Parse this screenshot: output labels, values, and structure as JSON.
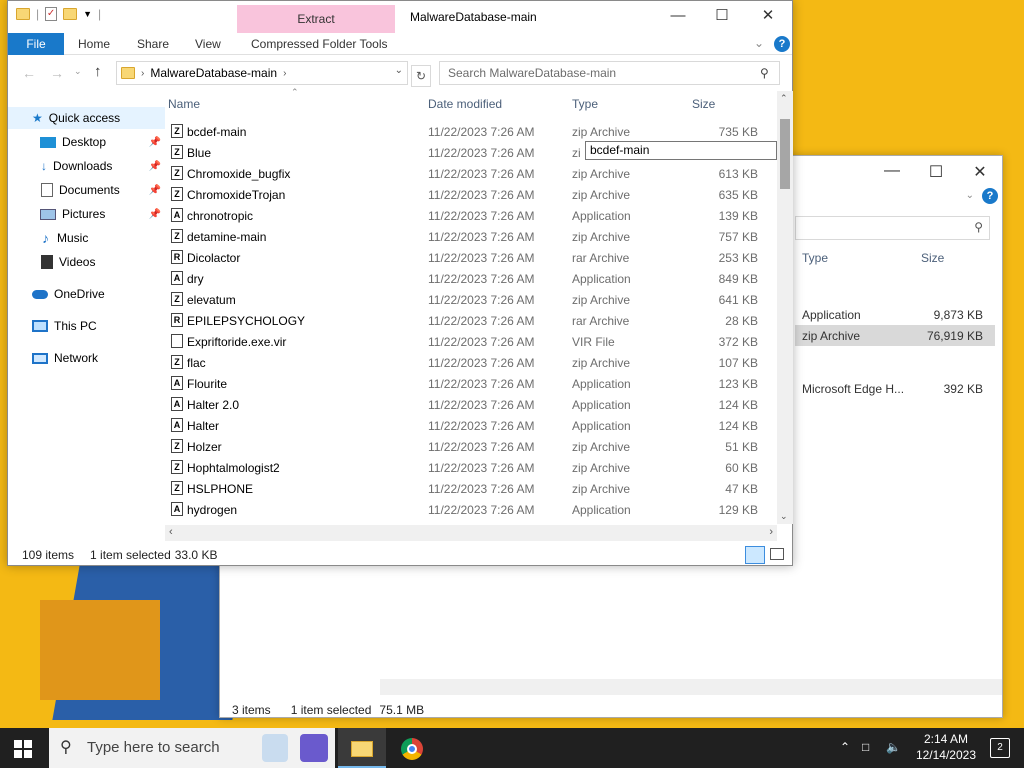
{
  "window": {
    "title": "MalwareDatabase-main",
    "extract_tab": "Extract",
    "ribbon_tabs": [
      "File",
      "Home",
      "Share",
      "View",
      "Compressed Folder Tools"
    ],
    "address": "MalwareDatabase-main",
    "search_placeholder": "Search MalwareDatabase-main",
    "columns": [
      "Name",
      "Date modified",
      "Type",
      "Size"
    ],
    "tooltip": "bcdef-main",
    "status_items": "109 items",
    "status_selected": "1 item selected",
    "status_size": "33.0 KB"
  },
  "nav": [
    {
      "label": "Quick access",
      "icon": "star-icon",
      "pinned": false
    },
    {
      "label": "Desktop",
      "icon": "desktop-icon",
      "pinned": true
    },
    {
      "label": "Downloads",
      "icon": "download-icon",
      "pinned": true
    },
    {
      "label": "Documents",
      "icon": "documents-icon",
      "pinned": true
    },
    {
      "label": "Pictures",
      "icon": "pictures-icon",
      "pinned": true
    },
    {
      "label": "Music",
      "icon": "music-icon",
      "pinned": false
    },
    {
      "label": "Videos",
      "icon": "videos-icon",
      "pinned": false
    },
    {
      "label": "OneDrive",
      "icon": "onedrive-icon",
      "pinned": false
    },
    {
      "label": "This PC",
      "icon": "pc-icon",
      "pinned": false
    },
    {
      "label": "Network",
      "icon": "network-icon",
      "pinned": false
    }
  ],
  "files": [
    {
      "name": "bcdef-main",
      "date": "11/22/2023 7:26 AM",
      "type": "zip Archive",
      "size": "735 KB",
      "icon": "Z"
    },
    {
      "name": "Blue",
      "date": "11/22/2023 7:26 AM",
      "type": "zi",
      "size": "",
      "icon": "Z"
    },
    {
      "name": "Chromoxide_bugfix",
      "date": "11/22/2023 7:26 AM",
      "type": "zip Archive",
      "size": "613 KB",
      "icon": "Z"
    },
    {
      "name": "ChromoxideTrojan",
      "date": "11/22/2023 7:26 AM",
      "type": "zip Archive",
      "size": "635 KB",
      "icon": "Z"
    },
    {
      "name": "chronotropic",
      "date": "11/22/2023 7:26 AM",
      "type": "Application",
      "size": "139 KB",
      "icon": "A"
    },
    {
      "name": "detamine-main",
      "date": "11/22/2023 7:26 AM",
      "type": "zip Archive",
      "size": "757 KB",
      "icon": "Z"
    },
    {
      "name": "Dicolactor",
      "date": "11/22/2023 7:26 AM",
      "type": "rar Archive",
      "size": "253 KB",
      "icon": "R"
    },
    {
      "name": "dry",
      "date": "11/22/2023 7:26 AM",
      "type": "Application",
      "size": "849 KB",
      "icon": "A"
    },
    {
      "name": "elevatum",
      "date": "11/22/2023 7:26 AM",
      "type": "zip Archive",
      "size": "641 KB",
      "icon": "Z"
    },
    {
      "name": "EPILEPSYCHOLOGY",
      "date": "11/22/2023 7:26 AM",
      "type": "rar Archive",
      "size": "28 KB",
      "icon": "R"
    },
    {
      "name": "Expriftoride.exe.vir",
      "date": "11/22/2023 7:26 AM",
      "type": "VIR File",
      "size": "372 KB",
      "icon": " "
    },
    {
      "name": "flac",
      "date": "11/22/2023 7:26 AM",
      "type": "zip Archive",
      "size": "107 KB",
      "icon": "Z"
    },
    {
      "name": "Flourite",
      "date": "11/22/2023 7:26 AM",
      "type": "Application",
      "size": "123 KB",
      "icon": "A"
    },
    {
      "name": "Halter 2.0",
      "date": "11/22/2023 7:26 AM",
      "type": "Application",
      "size": "124 KB",
      "icon": "A"
    },
    {
      "name": "Halter",
      "date": "11/22/2023 7:26 AM",
      "type": "Application",
      "size": "124 KB",
      "icon": "A"
    },
    {
      "name": "Holzer",
      "date": "11/22/2023 7:26 AM",
      "type": "zip Archive",
      "size": "51 KB",
      "icon": "Z"
    },
    {
      "name": "Hophtalmologist2",
      "date": "11/22/2023 7:26 AM",
      "type": "zip Archive",
      "size": "60 KB",
      "icon": "Z"
    },
    {
      "name": "HSLPHONE",
      "date": "11/22/2023 7:26 AM",
      "type": "zip Archive",
      "size": "47 KB",
      "icon": "Z"
    },
    {
      "name": "hydrogen",
      "date": "11/22/2023 7:26 AM",
      "type": "Application",
      "size": "129 KB",
      "icon": "A"
    }
  ],
  "back_window": {
    "columns": [
      "Type",
      "Size"
    ],
    "rows": [
      {
        "type": "Application",
        "size": "9,873 KB"
      },
      {
        "type": "zip Archive",
        "size": "76,919 KB"
      },
      {
        "type": "Microsoft Edge H...",
        "size": "392 KB"
      }
    ],
    "status_items": "3 items",
    "status_selected": "1 item selected",
    "status_size": "75.1 MB"
  },
  "taskbar": {
    "search_placeholder": "Type here to search",
    "time": "2:14 AM",
    "date": "12/14/2023",
    "notifications": "2"
  },
  "colors": {
    "accent": "#1979ca",
    "extract": "#f9c4dc",
    "taskbar": "#202020"
  }
}
